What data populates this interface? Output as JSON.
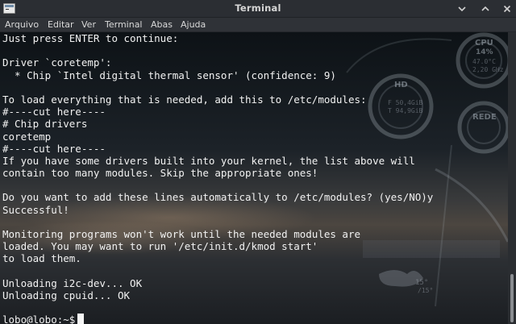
{
  "window": {
    "title": "Terminal"
  },
  "menu": {
    "items": [
      "Arquivo",
      "Editar",
      "Ver",
      "Terminal",
      "Abas",
      "Ajuda"
    ]
  },
  "terminal": {
    "lines": [
      "Just press ENTER to continue:",
      "",
      "Driver `coretemp':",
      "  * Chip `Intel digital thermal sensor' (confidence: 9)",
      "",
      "To load everything that is needed, add this to /etc/modules:",
      "#----cut here----",
      "# Chip drivers",
      "coretemp",
      "#----cut here----",
      "If you have some drivers built into your kernel, the list above will",
      "contain too many modules. Skip the appropriate ones!",
      "",
      "Do you want to add these lines automatically to /etc/modules? (yes/NO)y",
      "Successful!",
      "",
      "Monitoring programs won't work until the needed modules are",
      "loaded. You may want to run '/etc/init.d/kmod start'",
      "to load them.",
      "",
      "Unloading i2c-dev... OK",
      "Unloading cpuid... OK",
      ""
    ],
    "prompt": "lobo@lobo:~$"
  },
  "widgets": {
    "cpu_label": "CPU",
    "cpu_percent": "14%",
    "cpu_temp": "47.0°C",
    "cpu_freq": "2,20 GHz",
    "hd_label": "HD",
    "hd_free": "F 50,4GiB",
    "hd_total": "T 94,9GiB",
    "net_label": "REDE",
    "weather_temp": "15°",
    "weather_range": "/15°"
  },
  "icons": {
    "app": "terminal-icon",
    "minimize": "minimize-icon",
    "maximize": "maximize-icon",
    "close": "close-icon"
  }
}
